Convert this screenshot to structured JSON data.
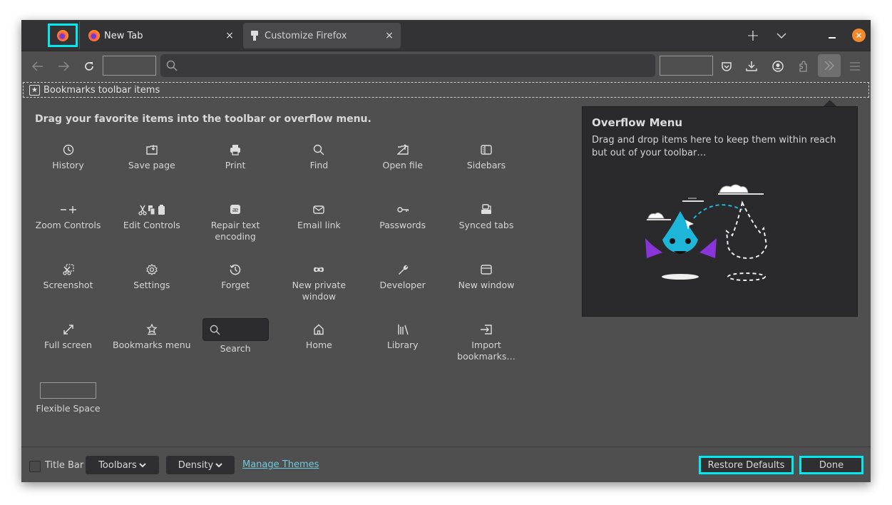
{
  "window": {
    "tabs": [
      {
        "label": "New Tab",
        "icon": "firefox-logo-icon",
        "active": false
      },
      {
        "label": "Customize Firefox",
        "icon": "paintbrush-icon",
        "active": true
      }
    ],
    "tab_close_glyph": "×",
    "new_tab_glyph": "+",
    "window_close_glyph": "✕"
  },
  "navbar": {
    "icons": [
      "back-arrow-icon",
      "forward-arrow-icon",
      "reload-icon",
      "search-icon",
      "pocket-icon",
      "download-icon",
      "account-icon",
      "extensions-icon",
      "overflow-chevron-icon",
      "hamburger-menu-icon"
    ]
  },
  "bookmarks_toolbar": {
    "label": "Bookmarks toolbar items"
  },
  "palette": {
    "title": "Drag your favorite items into the toolbar or overflow menu.",
    "items": [
      {
        "label": "History",
        "icon": "clock-icon"
      },
      {
        "label": "Save page",
        "icon": "save-page-icon"
      },
      {
        "label": "Print",
        "icon": "printer-icon"
      },
      {
        "label": "Find",
        "icon": "magnifier-icon"
      },
      {
        "label": "Open file",
        "icon": "open-file-icon"
      },
      {
        "label": "Sidebars",
        "icon": "sidebar-icon"
      },
      {
        "label": "Zoom Controls",
        "icon": "zoom-controls-icon"
      },
      {
        "label": "Edit Controls",
        "icon": "edit-controls-icon"
      },
      {
        "label": "Repair text encoding",
        "icon": "text-encoding-icon"
      },
      {
        "label": "Email link",
        "icon": "envelope-icon"
      },
      {
        "label": "Passwords",
        "icon": "key-icon"
      },
      {
        "label": "Synced tabs",
        "icon": "synced-tabs-icon"
      },
      {
        "label": "Screenshot",
        "icon": "screenshot-icon"
      },
      {
        "label": "Settings",
        "icon": "gear-icon"
      },
      {
        "label": "Forget",
        "icon": "forget-icon"
      },
      {
        "label": "New private window",
        "icon": "private-mask-icon"
      },
      {
        "label": "Developer",
        "icon": "wrench-icon"
      },
      {
        "label": "New window",
        "icon": "new-window-icon"
      },
      {
        "label": "Full screen",
        "icon": "fullscreen-arrows-icon"
      },
      {
        "label": "Bookmarks menu",
        "icon": "bookmark-star-icon"
      },
      {
        "label": "Search",
        "icon": "search-box-icon"
      },
      {
        "label": "Home",
        "icon": "home-icon"
      },
      {
        "label": "Library",
        "icon": "library-icon"
      },
      {
        "label": "Import bookmarks…",
        "icon": "import-icon"
      },
      {
        "label": "Flexible Space",
        "icon": "flexible-space"
      }
    ]
  },
  "overflow_panel": {
    "title": "Overflow Menu",
    "description": "Drag and drop items here to keep them within reach but out of your toolbar…"
  },
  "footer": {
    "title_bar_label": "Title Bar",
    "title_bar_checked": false,
    "toolbars_label": "Toolbars",
    "density_label": "Density",
    "manage_themes_label": "Manage Themes",
    "restore_defaults_label": "Restore Defaults",
    "done_label": "Done"
  },
  "colors": {
    "highlight": "#00eaf0",
    "link": "#6ec9de",
    "close_button": "#f28a2c",
    "background": "#4f4f4f",
    "tabstrip": "#333335"
  }
}
